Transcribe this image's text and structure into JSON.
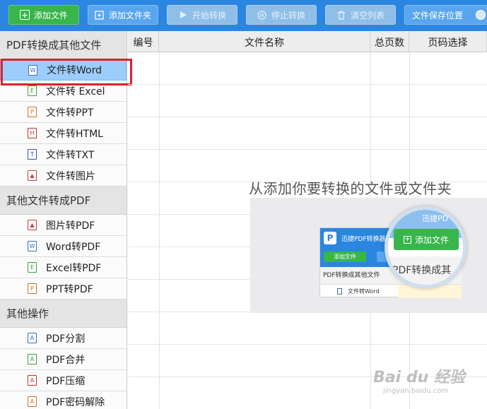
{
  "toolbar": {
    "add_file": "添加文件",
    "add_folder": "添加文件夹",
    "start": "开始转换",
    "stop": "停止转换",
    "clear": "清空列表",
    "save_location": "文件保存位置"
  },
  "sidebar": {
    "section1": {
      "title": "PDF转换成其他文件",
      "items": [
        {
          "label": "文件转Word",
          "icon": "word-icon",
          "glyph": "W",
          "color": "#3a6fc4"
        },
        {
          "label": "文件转 Excel",
          "icon": "excel-icon",
          "glyph": "E",
          "color": "#3d9b3d"
        },
        {
          "label": "文件转PPT",
          "icon": "ppt-icon",
          "glyph": "P",
          "color": "#d0702a"
        },
        {
          "label": "文件转HTML",
          "icon": "html-icon",
          "glyph": "H",
          "color": "#c03030"
        },
        {
          "label": "文件转TXT",
          "icon": "txt-icon",
          "glyph": "T",
          "color": "#3a4fb0"
        },
        {
          "label": "文件转图片",
          "icon": "image-icon",
          "glyph": "▲",
          "color": "#c04040"
        }
      ]
    },
    "section2": {
      "title": "其他文件转成PDF",
      "items": [
        {
          "label": "图片转PDF",
          "icon": "image-icon",
          "glyph": "▲",
          "color": "#c04040"
        },
        {
          "label": "Word转PDF",
          "icon": "word-icon",
          "glyph": "W",
          "color": "#3a6fc4"
        },
        {
          "label": "Excel转PDF",
          "icon": "excel-icon",
          "glyph": "E",
          "color": "#3d9b3d"
        },
        {
          "label": "PPT转PDF",
          "icon": "ppt-icon",
          "glyph": "P",
          "color": "#d0702a"
        }
      ]
    },
    "section3": {
      "title": "其他操作",
      "items": [
        {
          "label": "PDF分割",
          "icon": "pdf-icon",
          "glyph": "A",
          "color": "#3a6fc4"
        },
        {
          "label": "PDF合并",
          "icon": "pdf-icon",
          "glyph": "A",
          "color": "#3d9b3d"
        },
        {
          "label": "PDF压缩",
          "icon": "pdf-icon",
          "glyph": "A",
          "color": "#c03030"
        },
        {
          "label": "PDF密码解除",
          "icon": "pdf-icon",
          "glyph": "A",
          "color": "#d0702a"
        }
      ]
    }
  },
  "table": {
    "columns": [
      "编号",
      "文件名称",
      "总页数",
      "页码选择"
    ]
  },
  "guide": {
    "text": "从添加你要转换的文件或文件夹",
    "mini_title": "迅捷PDF转换器",
    "mini_add": "添加文件",
    "mini_section": "PDF转换成其他文件",
    "mini_item": "文件转Word",
    "mag_title": "迅捷PD",
    "mag_add": "添加文件",
    "mag_section": "PDF转换成其"
  },
  "watermark": {
    "main": "Bai du 经验",
    "sub": "jingyan.baidu.com"
  },
  "colors": {
    "toolbar": "#2a86e0",
    "green_button": "#38b54b",
    "active_item": "#9ccdfb",
    "highlight_box": "#d8242a"
  }
}
